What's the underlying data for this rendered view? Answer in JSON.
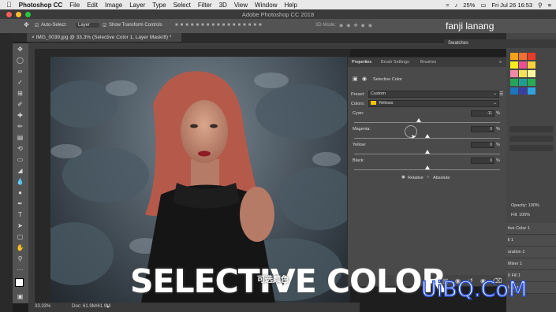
{
  "menubar": {
    "app_name": "Photoshop CC",
    "items": [
      "File",
      "Edit",
      "Image",
      "Layer",
      "Type",
      "Select",
      "Filter",
      "3D",
      "View",
      "Window",
      "Help"
    ],
    "battery": "25%",
    "clock": "Fri Jul 26  16:53"
  },
  "window": {
    "title": "Adobe Photoshop CC 2018"
  },
  "options_bar": {
    "auto_select": "Auto-Select:",
    "auto_select_value": "Layer",
    "transform_controls": "Show Transform Controls",
    "mode_3d": "3D Mode:"
  },
  "user_name": "fanji lanang",
  "document_tab": {
    "label": "IMG_0039.jpg @ 33.3% (Selective Color 1, Layer Mask/8) *"
  },
  "properties": {
    "tabs": [
      "Properties",
      "Brush Settings",
      "Brushes"
    ],
    "header": "Selective Color",
    "preset_label": "Preset:",
    "preset_value": "Custom",
    "colors_label": "Colors:",
    "colors_value": "Yellows",
    "colors_swatch": "#f2c200",
    "sliders": [
      {
        "label": "Cyan:",
        "value": "-11",
        "pct": "%",
        "level": -11
      },
      {
        "label": "Magenta:",
        "value": "0",
        "pct": "%",
        "level": 0
      },
      {
        "label": "Yellow:",
        "value": "0",
        "pct": "%",
        "level": 0
      },
      {
        "label": "Black:",
        "value": "0",
        "pct": "%",
        "level": 0
      }
    ],
    "method_relative": "Relative",
    "method_absolute": "Absolute"
  },
  "right_panel": {
    "swatches_tab": "Swatches",
    "opacity": "Opacity: 100%",
    "fill": "Fill: 100%",
    "layers": [
      "tive Color 1",
      "ll 1",
      "uration 1",
      "Mixer 1",
      "II Fill 1",
      "Layer"
    ]
  },
  "status": {
    "zoom": "33.33%",
    "doc": "Doc: 61.9M/61.9M"
  },
  "overlay": {
    "title": "SELECTIVE COLOR",
    "subtitle": "可选颜色",
    "watermark": "UiBQ.CoM"
  },
  "colors": {
    "accent_blue": "#2a4fd0"
  }
}
